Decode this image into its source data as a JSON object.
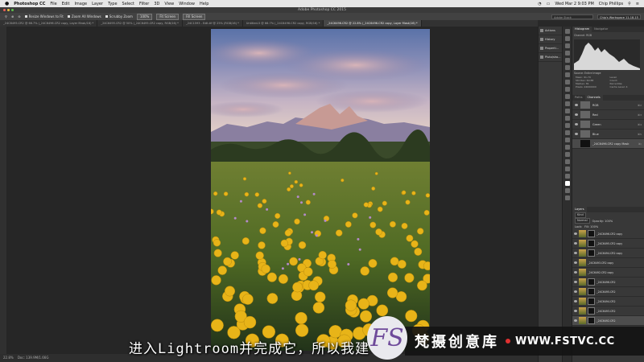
{
  "menubar": {
    "app": "Photoshop CC",
    "items": [
      "File",
      "Edit",
      "Image",
      "Layer",
      "Type",
      "Select",
      "Filter",
      "3D",
      "View",
      "Window",
      "Help"
    ],
    "datetime": "Wed Mar 2  9:03 PM",
    "user": "Chip Phillips"
  },
  "window": {
    "title": "Adobe Photoshop CC 2015"
  },
  "options_bar": {
    "resize_windows": "Resize Windows to Fit",
    "zoom_all": "Zoom All Windows",
    "scrubby_zoom": "Scrubby Zoom",
    "zoom_level": "100%",
    "fit_screen": "Fit Screen",
    "fill_screen": "Fill Screen",
    "search_placeholder": "Adobe Stock",
    "workspace": "Chip's Workspace 11-18-15"
  },
  "tabs": [
    "_24C6495.CR2 @ 66.7% (_24C6496.CR2 copy, Layer Mask/16) *",
    "_24C6495.CR2 @ 50% (_24C6495.CR2 copy, RGB/16) *",
    "_24C1593 - Edit.tif @ 25% (RGB/16) *",
    "Untitled-5 @ 66.7% (_24C6496.CR2 copy, RGB/16) *",
    "_24C6496.CR2 @ 22.8% (_24C6496.CR2 copy, Layer Mask/16) *"
  ],
  "active_tab": 4,
  "status": {
    "zoom": "22.8%",
    "doc": "Doc: 139.9M/1.66G"
  },
  "mini_panels": [
    "Actions",
    "History",
    "Properti...",
    "Pluto/sho..."
  ],
  "histogram": {
    "tab1": "Histogram",
    "tab2": "Navigator",
    "channel_label": "Channel:",
    "channel": "RGB",
    "source_label": "Source:",
    "source": "Entire Image",
    "stats": [
      "Mean: 91.79",
      "Level:",
      "Std Dev: 60.88",
      "Count:",
      "Median: 81",
      "Percentile:",
      "Pixels: 24000000",
      "Cache Level: 4"
    ]
  },
  "channels": {
    "tab1": "Paths",
    "tab2": "Channels",
    "rows": [
      {
        "name": "RGB",
        "shortcut": "⌘2"
      },
      {
        "name": "Red",
        "shortcut": "⌘3"
      },
      {
        "name": "Green",
        "shortcut": "⌘4"
      },
      {
        "name": "Blue",
        "shortcut": "⌘5"
      },
      {
        "name": "_24C6496.CR2 copy Mask",
        "shortcut": "⌘\\"
      }
    ]
  },
  "layers": {
    "tab": "Layers",
    "kind": "Kind",
    "blend": "Normal",
    "opacity": "Opacity: 100%",
    "lock": "Lock:",
    "fill": "Fill: 100%",
    "rows": [
      "_24C6496.CR2 copy",
      "_24C6495.CR2 copy",
      "_24C6494.CR2 copy",
      "_24C6493.CR2 copy",
      "_24C6492.CR2 copy",
      "_24C6496.CR2",
      "_24C6495.CR2",
      "_24C6494.CR2",
      "_24C6493.CR2",
      "_24C6492.CR2"
    ]
  },
  "subtitle": "进入Lightroom并完成它，所以我建",
  "watermark": {
    "logo_letters": "FS",
    "cn": "梵摄创意库",
    "url": "WWW.FSTVC.CC"
  },
  "colors": {
    "accent": "#6e4a9a",
    "sky_top": "#5a72a8",
    "flower": "#e8b418",
    "meadow": "#4f6a24"
  }
}
